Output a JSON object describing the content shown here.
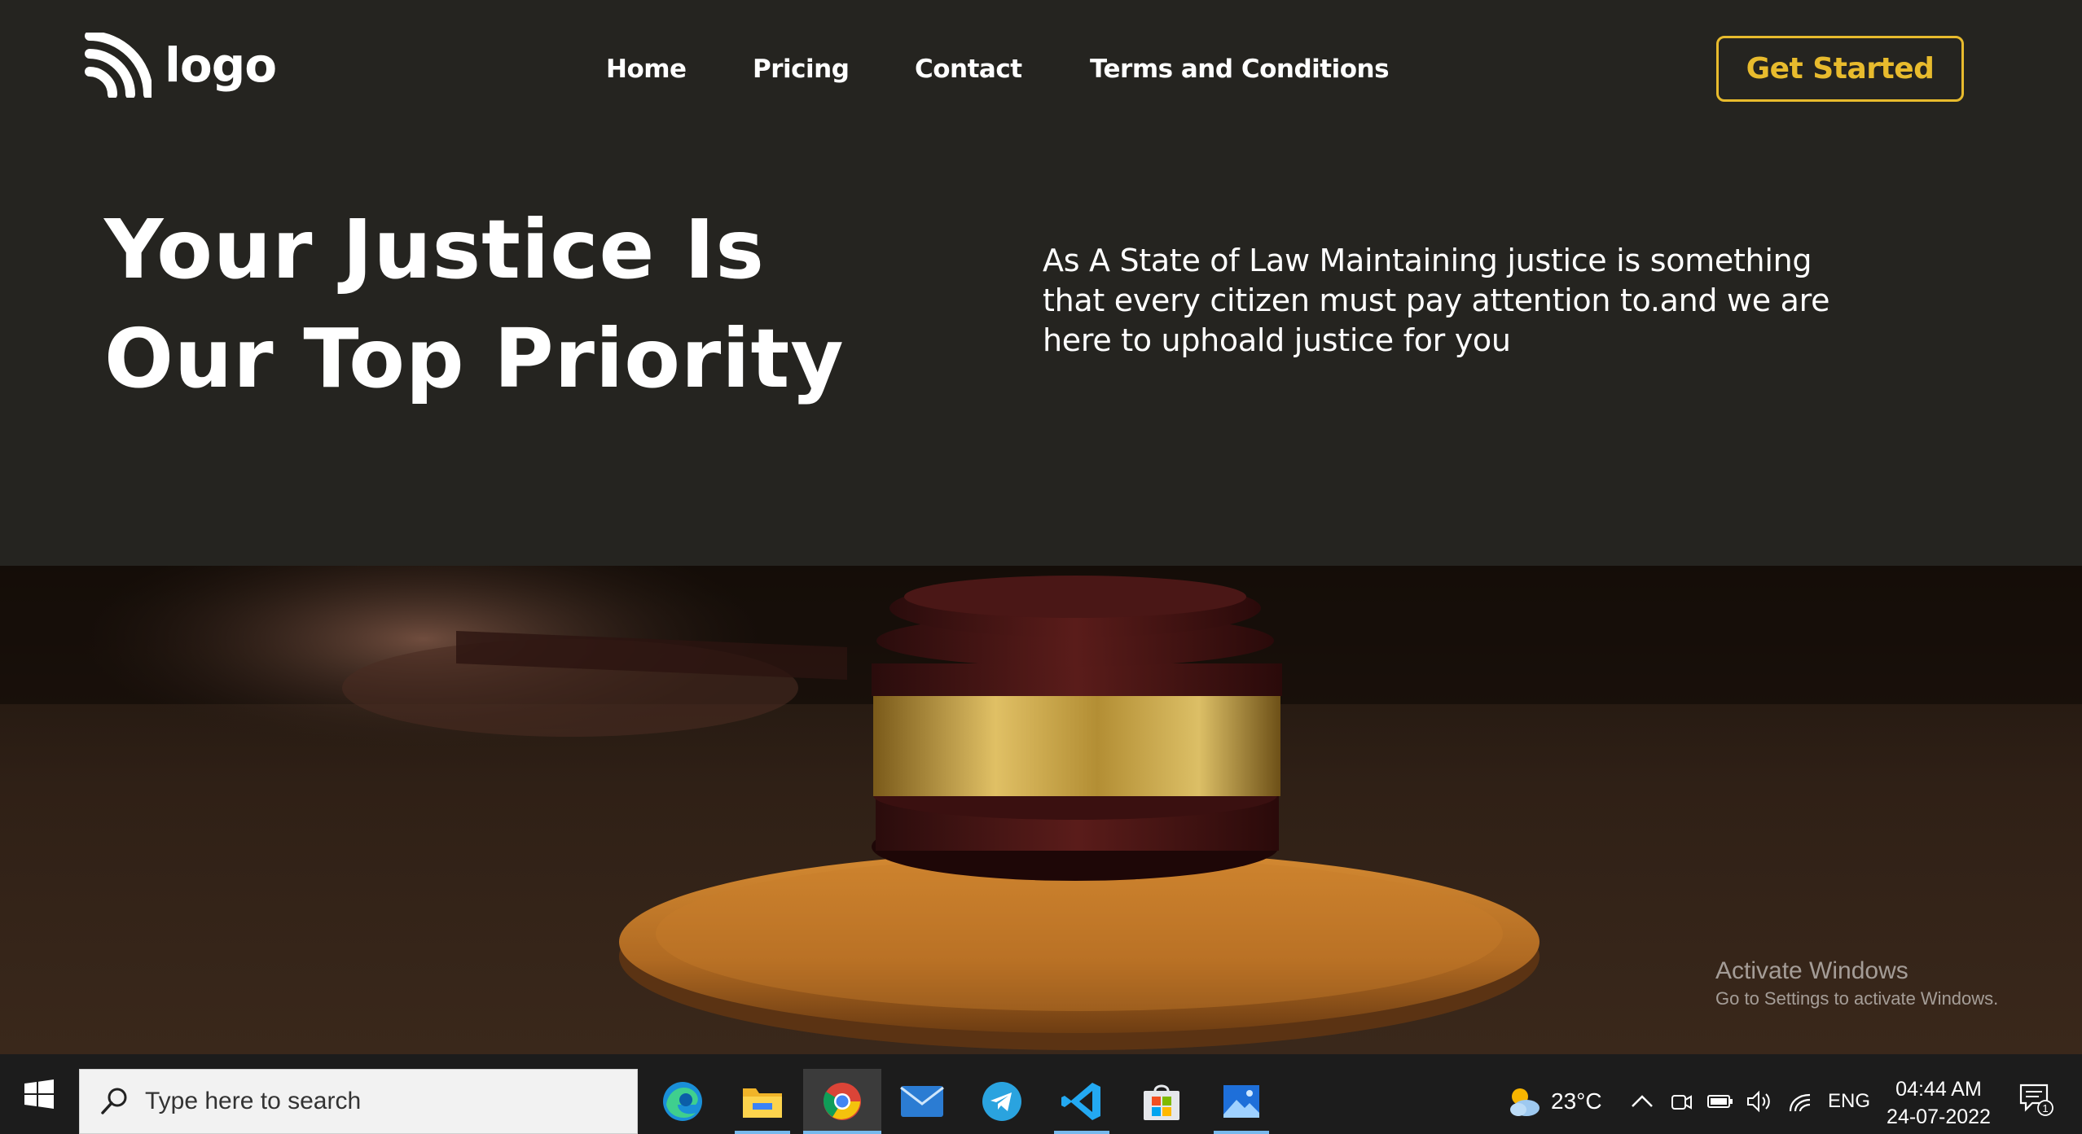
{
  "header": {
    "logo_text": "logo",
    "nav": [
      "Home",
      "Pricing",
      "Contact",
      "Terms and Conditions"
    ],
    "cta_label": "Get Started"
  },
  "hero": {
    "title_line1": "Your Justice Is",
    "title_line2": "Our Top Priority",
    "description": "As A State of Law Maintaining justice is something that every citizen must pay attention to.and we are here to uphoald justice for you"
  },
  "watermark": {
    "title": "Activate Windows",
    "subtitle": "Go to Settings to activate Windows."
  },
  "taskbar": {
    "search_placeholder": "Type here to search",
    "apps": [
      "edge-icon",
      "file-explorer-icon",
      "chrome-icon",
      "mail-icon",
      "telegram-icon",
      "vscode-icon",
      "store-icon",
      "photos-icon"
    ],
    "temperature": "23°C",
    "language": "ENG",
    "time": "04:44 AM",
    "date": "24-07-2022",
    "notification_count": "1"
  },
  "colors": {
    "background": "#252420",
    "accent": "#e8bb2d",
    "taskbar": "#1c1c1c"
  }
}
